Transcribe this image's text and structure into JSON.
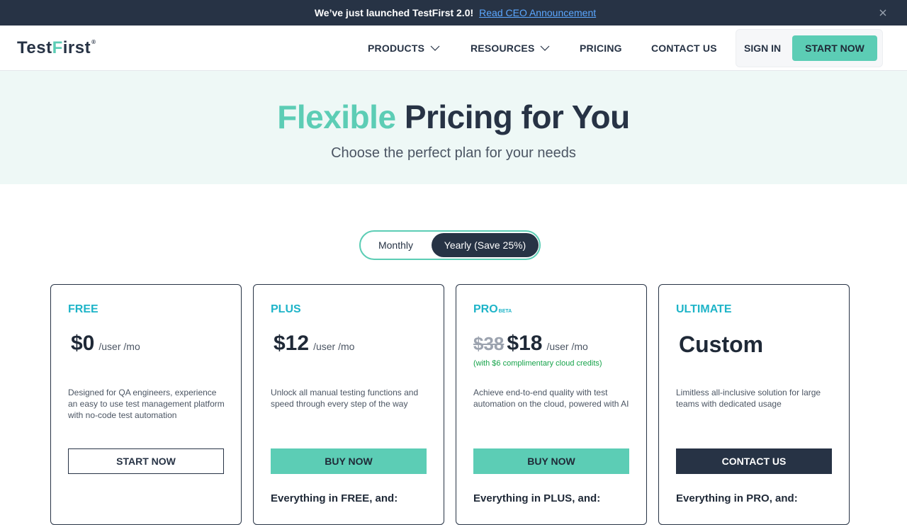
{
  "announcement": {
    "glyph": "",
    "text": "We’ve just launched TestFirst 2.0!",
    "link": "Read CEO Announcement"
  },
  "logo": {
    "part1": "Test",
    "f": "F",
    "part2": "irst",
    "reg": "®"
  },
  "nav": {
    "products": "PRODUCTS",
    "resources": "RESOURCES",
    "pricing": "PRICING",
    "contact": "CONTACT US",
    "signin": "SIGN IN",
    "start": "START NOW"
  },
  "hero": {
    "accent": "Flexible",
    "title_rest": "Pricing for You",
    "subtitle": "Choose the perfect plan for your needs"
  },
  "billing_toggle": {
    "monthly": "Monthly",
    "yearly": "Yearly (Save 25%)",
    "selected": "Yearly (Save 25%)"
  },
  "plans": [
    {
      "name": "FREE",
      "price": "$0",
      "unit": "/user /mo",
      "description": "Designed for QA engineers, experience an easy to use test management platform with no-code test automation",
      "cta": "START NOW",
      "includes": ""
    },
    {
      "name": "PLUS",
      "price": "$12",
      "unit": "/user /mo",
      "description": "Unlock all manual testing functions and speed through every step of the way",
      "cta": "BUY NOW",
      "includes": "Everything in FREE, and:"
    },
    {
      "name": "PRO",
      "badge": "BETA",
      "old_price": "$38",
      "price": "$18",
      "unit": "/user /mo",
      "credit": "(with $6 complimentary cloud credits)",
      "description": "Achieve end-to-end quality with test automation on the cloud, powered with AI",
      "cta": "BUY NOW",
      "includes": "Everything in PLUS, and:"
    },
    {
      "name": "ULTIMATE",
      "price": "Custom",
      "description": "Limitless all-inclusive solution for large teams with dedicated usage",
      "cta": "CONTACT US",
      "includes": "Everything in PRO, and:"
    }
  ],
  "colors": {
    "dark": "#273345",
    "accent": "#5ccdb5",
    "plan_label": "#1eb4c8",
    "credit": "#16a34a"
  }
}
